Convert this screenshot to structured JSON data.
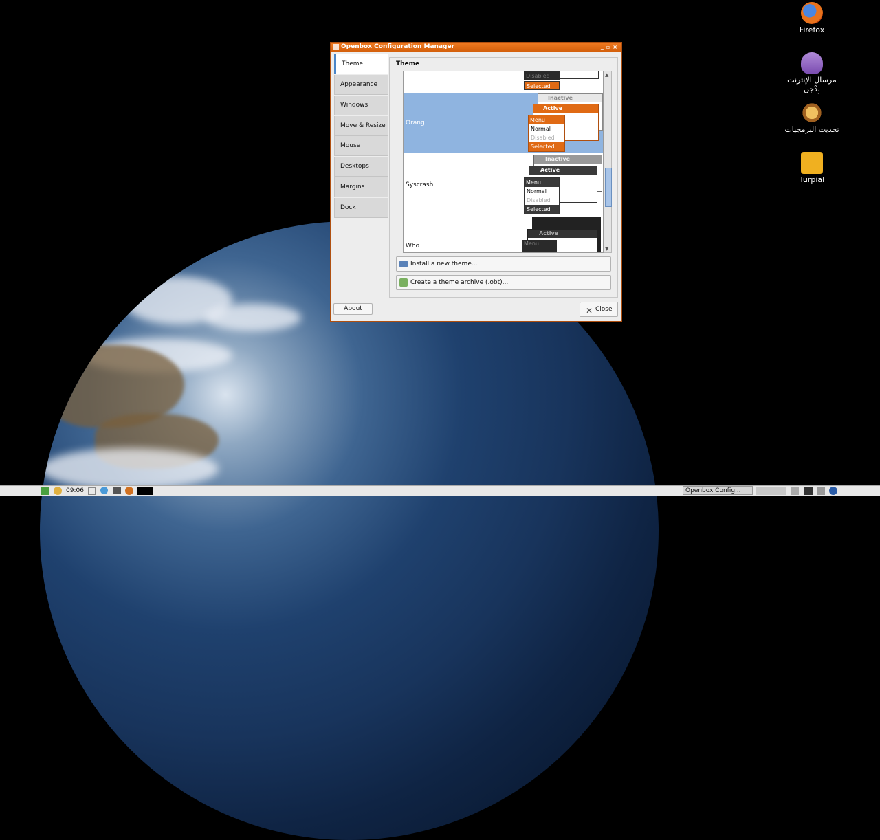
{
  "desktop": {
    "icons": [
      {
        "label": "Firefox",
        "icon": "firefox-icon"
      },
      {
        "label": "مرسال الإنترنت بِدْجن",
        "icon": "pidgin-icon"
      },
      {
        "label": "تحديث البرمجيات",
        "icon": "software-update-icon"
      },
      {
        "label": "Turpial",
        "icon": "turpial-icon"
      }
    ]
  },
  "window": {
    "title": "Openbox Configuration Manager",
    "controls": [
      "_",
      "▫",
      "×"
    ],
    "tabs": [
      {
        "label": "Theme"
      },
      {
        "label": "Appearance"
      },
      {
        "label": "Windows"
      },
      {
        "label": "Move & Resize"
      },
      {
        "label": "Mouse"
      },
      {
        "label": "Desktops"
      },
      {
        "label": "Margins"
      },
      {
        "label": "Dock"
      }
    ],
    "section_title": "Theme",
    "themes": [
      {
        "name": "Orang",
        "inactive": "Inactive",
        "active": "Active",
        "menu": [
          "Menu",
          "Normal",
          "Disabled",
          "Selected"
        ]
      },
      {
        "name": "Syscrash",
        "inactive": "Inactive",
        "active": "Active",
        "menu": [
          "Menu",
          "Normal",
          "Disabled",
          "Selected"
        ]
      },
      {
        "name": "Who",
        "active": "Active",
        "menu": [
          "Menu"
        ]
      }
    ],
    "prev_theme_preview": {
      "disabled": "Disabled",
      "selected": "Selected"
    },
    "install_button": "Install a new theme...",
    "archive_button": "Create a theme archive (.obt)...",
    "about_button": "About",
    "close_button": "Close"
  },
  "taskbar": {
    "clock": "09:06",
    "task_label": "Openbox Config..."
  },
  "colors": {
    "accent_orange": "#e06a14",
    "selection_blue": "#8fb4e0",
    "syscrash_dark": "#3a3a3a"
  }
}
